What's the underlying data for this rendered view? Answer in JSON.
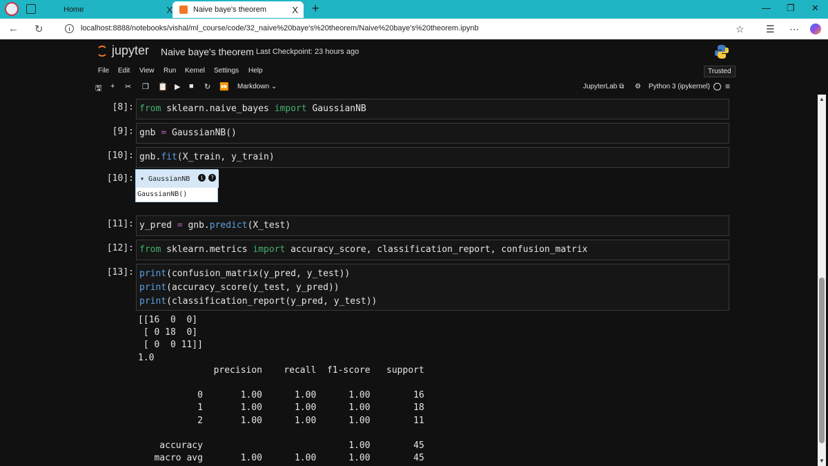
{
  "browser": {
    "tabs": [
      {
        "label": "Home"
      },
      {
        "label": "Naive baye's theorem"
      }
    ],
    "new_tab": "+",
    "tab_close": "X",
    "url": "localhost:8888/notebooks/vishal/ml_course/code/32_naive%20baye's%20theorem/Naive%20baye's%20theorem.ipynb",
    "window_controls": {
      "minimize": "—",
      "restore": "❐",
      "close": "✕"
    }
  },
  "jupyter": {
    "brand": "jupyter",
    "notebook_title": "Naive baye's theorem",
    "checkpoint": "Last Checkpoint: 23 hours ago",
    "menu": [
      "File",
      "Edit",
      "View",
      "Run",
      "Kernel",
      "Settings",
      "Help"
    ],
    "trusted": "Trusted",
    "cell_type": "Markdown",
    "jupyterlab_link": "JupyterLab",
    "kernel": "Python 3 (ipykernel)"
  },
  "cells": [
    {
      "prompt": "[8]:"
    },
    {
      "prompt": "[9]:"
    },
    {
      "prompt": "[10]:"
    },
    {
      "prompt": "[10]:",
      "widget_title": "GaussianNB",
      "widget_body": "GaussianNB()"
    },
    {
      "prompt": "[11]:"
    },
    {
      "prompt": "[12]:"
    },
    {
      "prompt": "[13]:"
    }
  ],
  "code": {
    "c8": {
      "k1": "from",
      "a": " sklearn.naive_bayes ",
      "k2": "import",
      "b": " GaussianNB"
    },
    "c9": {
      "a": "gnb ",
      "op": "=",
      "b": " GaussianNB()"
    },
    "c10": {
      "a": "gnb.",
      "f": "fit",
      "b": "(X_train, y_train)"
    },
    "c11": {
      "a": "y_pred ",
      "op": "=",
      "b": " gnb.",
      "f": "predict",
      "c": "(X_test)"
    },
    "c12": {
      "k1": "from",
      "a": " sklearn.metrics ",
      "k2": "import",
      "b": " accuracy_score, classification_report, confusion_matrix"
    },
    "c13": [
      {
        "f": "print",
        "a": "(confusion_matrix(y_pred, y_test))"
      },
      {
        "f": "print",
        "a": "(accuracy_score(y_test, y_pred))"
      },
      {
        "f": "print",
        "a": "(classification_report(y_pred, y_test))"
      }
    ]
  },
  "output13": [
    "[[16  0  0]",
    " [ 0 18  0]",
    " [ 0  0 11]]",
    "1.0",
    "              precision    recall  f1-score   support",
    "",
    "           0       1.00      1.00      1.00        16",
    "           1       1.00      1.00      1.00        18",
    "           2       1.00      1.00      1.00        11",
    "",
    "    accuracy                           1.00        45",
    "   macro avg       1.00      1.00      1.00        45"
  ]
}
